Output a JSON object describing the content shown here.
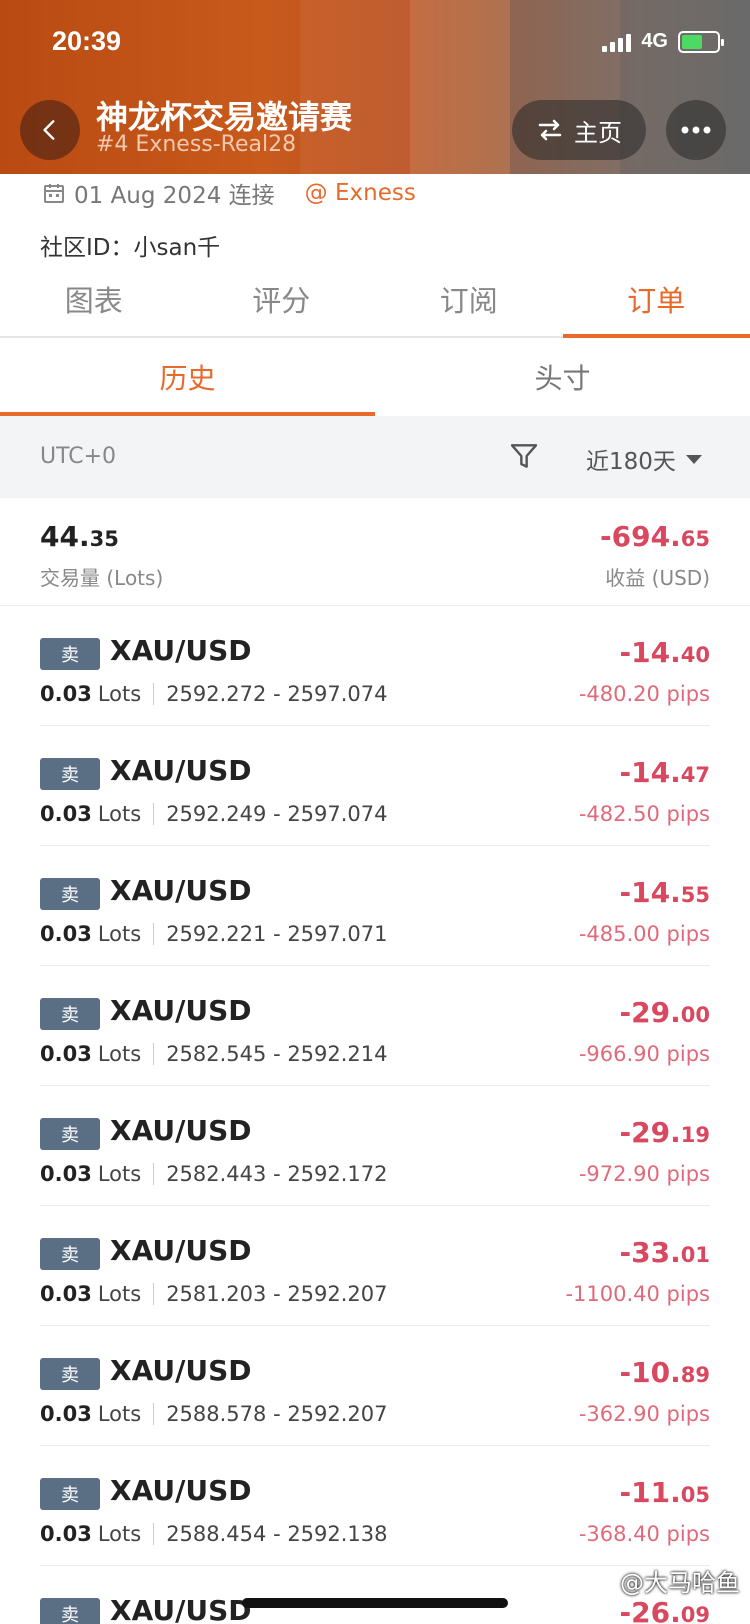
{
  "status_bar": {
    "time": "20:39",
    "network": "4G"
  },
  "header": {
    "title": "神龙杯交易邀请赛",
    "subtitle": "#4 Exness-Real28",
    "home_label": "主页"
  },
  "info": {
    "connect_date": "01 Aug 2024 连接",
    "broker": "@ Exness",
    "community_id": "社区ID：小san千"
  },
  "tabs": [
    "图表",
    "评分",
    "订阅",
    "订单"
  ],
  "active_tab": "订单",
  "subtabs": [
    "历史",
    "头寸"
  ],
  "active_subtab": "历史",
  "filter": {
    "timezone": "UTC+0",
    "range": "近180天"
  },
  "summary": {
    "volume_int": "44.",
    "volume_dec": "35",
    "volume_label": "交易量 (Lots)",
    "pnl_int": "-694.",
    "pnl_dec": "65",
    "pnl_label": "收益 (USD)"
  },
  "orders": [
    {
      "side": "卖",
      "symbol": "XAU/USD",
      "lots": "0.03",
      "lots_unit": "Lots",
      "range": "2592.272 - 2597.074",
      "profit_int": "-14.",
      "profit_dec": "40",
      "pips": "-480.20 pips"
    },
    {
      "side": "卖",
      "symbol": "XAU/USD",
      "lots": "0.03",
      "lots_unit": "Lots",
      "range": "2592.249 - 2597.074",
      "profit_int": "-14.",
      "profit_dec": "47",
      "pips": "-482.50 pips"
    },
    {
      "side": "卖",
      "symbol": "XAU/USD",
      "lots": "0.03",
      "lots_unit": "Lots",
      "range": "2592.221 - 2597.071",
      "profit_int": "-14.",
      "profit_dec": "55",
      "pips": "-485.00 pips"
    },
    {
      "side": "卖",
      "symbol": "XAU/USD",
      "lots": "0.03",
      "lots_unit": "Lots",
      "range": "2582.545 - 2592.214",
      "profit_int": "-29.",
      "profit_dec": "00",
      "pips": "-966.90 pips"
    },
    {
      "side": "卖",
      "symbol": "XAU/USD",
      "lots": "0.03",
      "lots_unit": "Lots",
      "range": "2582.443 - 2592.172",
      "profit_int": "-29.",
      "profit_dec": "19",
      "pips": "-972.90 pips"
    },
    {
      "side": "卖",
      "symbol": "XAU/USD",
      "lots": "0.03",
      "lots_unit": "Lots",
      "range": "2581.203 - 2592.207",
      "profit_int": "-33.",
      "profit_dec": "01",
      "pips": "-1100.40 pips"
    },
    {
      "side": "卖",
      "symbol": "XAU/USD",
      "lots": "0.03",
      "lots_unit": "Lots",
      "range": "2588.578 - 2592.207",
      "profit_int": "-10.",
      "profit_dec": "89",
      "pips": "-362.90 pips"
    },
    {
      "side": "卖",
      "symbol": "XAU/USD",
      "lots": "0.03",
      "lots_unit": "Lots",
      "range": "2588.454 - 2592.138",
      "profit_int": "-11.",
      "profit_dec": "05",
      "pips": "-368.40 pips"
    },
    {
      "side": "卖",
      "symbol": "XAU/USD",
      "lots": "",
      "lots_unit": "",
      "range": "",
      "profit_int": "-26.",
      "profit_dec": "09",
      "pips": ""
    }
  ],
  "watermark": "@大马哈鱼",
  "colors": {
    "accent": "#e86a2b",
    "loss": "#d9485f",
    "badge": "#5a6e84"
  }
}
